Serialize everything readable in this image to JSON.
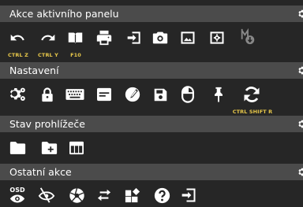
{
  "sections": [
    {
      "title": "Akce aktivního panelu",
      "shortcuts": [
        "CTRL Z",
        "CTRL Y",
        "F10"
      ]
    },
    {
      "title": "Nastavení",
      "shortcuts": [
        "CTRL SHIFT R"
      ]
    },
    {
      "title": "Stav prohlížeče",
      "shortcuts": []
    },
    {
      "title": "Ostatní akce",
      "osd_label": "OSD",
      "shortcuts": []
    }
  ],
  "icons": {
    "panel_actions": [
      "undo-icon",
      "redo-icon",
      "book-icon",
      "print-icon",
      "sign-in-icon",
      "camera-icon",
      "image-icon",
      "image-settings-icon",
      "split-view-icon"
    ],
    "settings": [
      "gears-icon",
      "lock-icon",
      "keyboard-icon",
      "card-icon",
      "theme-icon",
      "save-icon",
      "mouse-icon",
      "pin-icon",
      "reload-icon"
    ],
    "browser_state": [
      "folder-icon",
      "new-folder-icon",
      "table-icon"
    ],
    "other": [
      "osd-eye-icon",
      "eye-slash-icon",
      "aperture-icon",
      "exchange-icon",
      "widgets-icon",
      "help-icon",
      "export-icon"
    ]
  },
  "colors": {
    "background": "#262626",
    "header": "#4b4b4b",
    "shortcut": "#e8c84a",
    "icon": "#ffffff"
  }
}
